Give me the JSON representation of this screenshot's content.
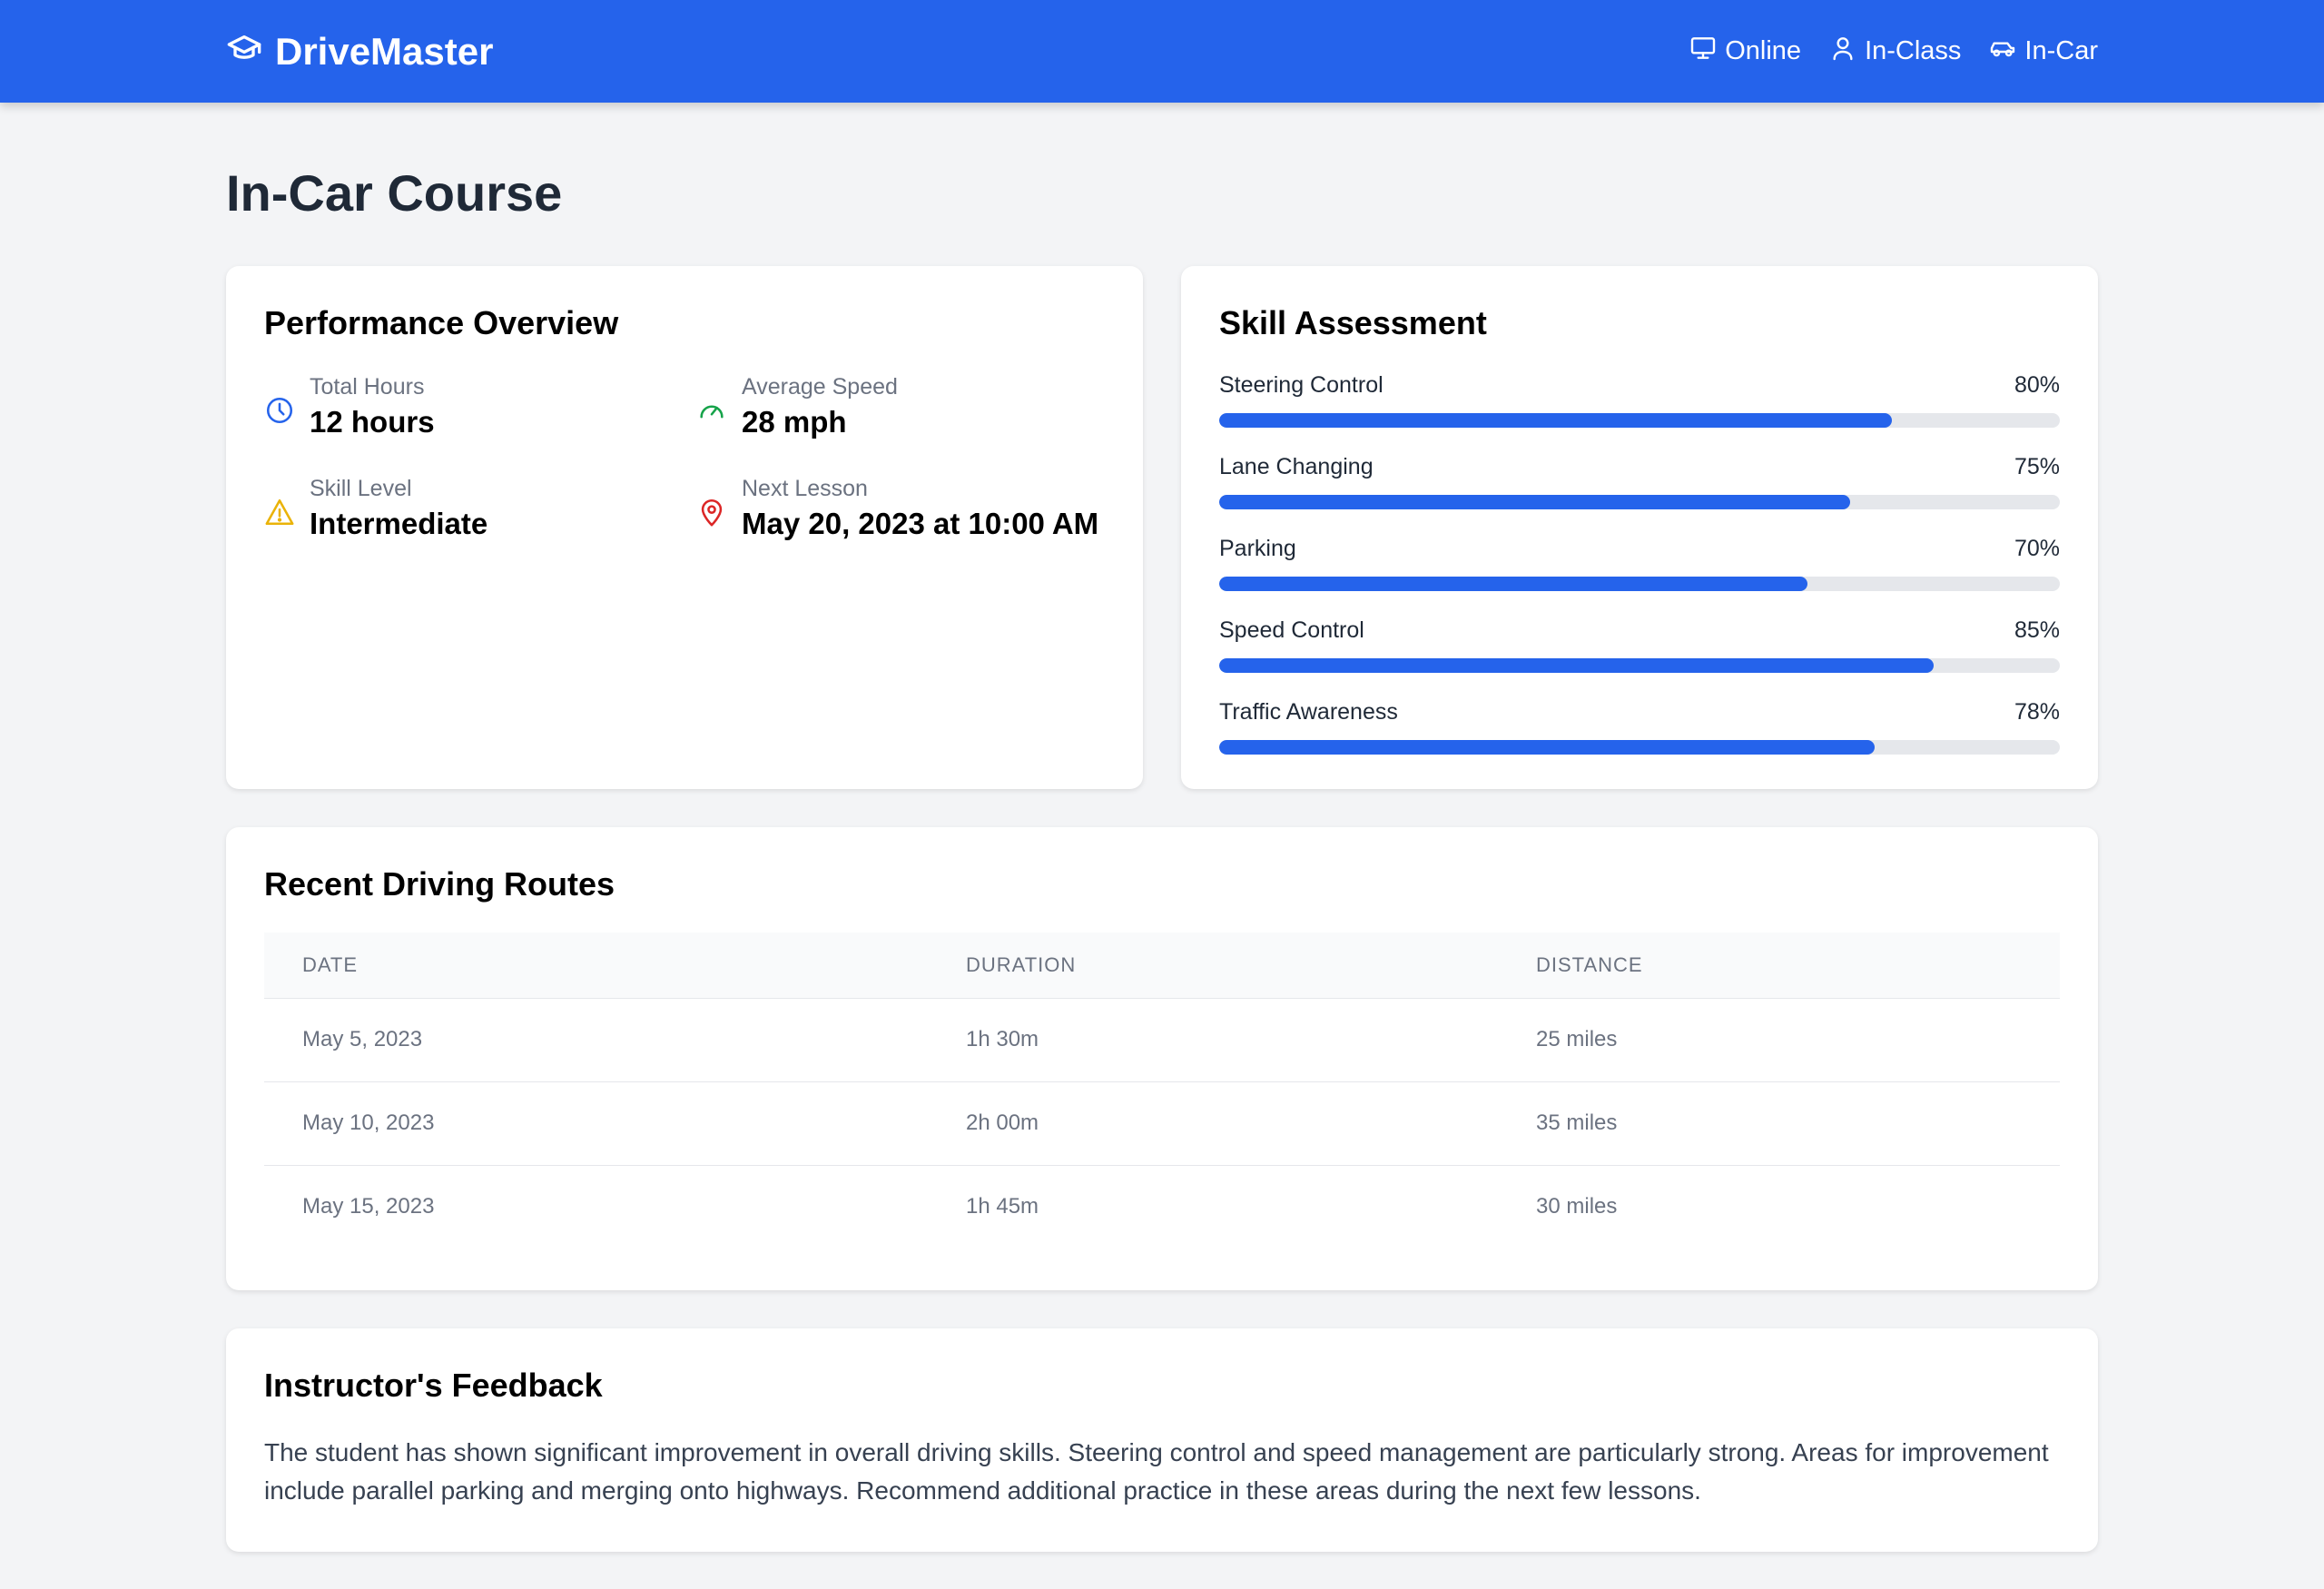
{
  "app": {
    "name": "DriveMaster",
    "logo_icon": "graduation-cap-icon"
  },
  "nav": [
    {
      "label": "Online",
      "icon": "monitor-icon"
    },
    {
      "label": "In-Class",
      "icon": "user-icon"
    },
    {
      "label": "In-Car",
      "icon": "car-icon"
    }
  ],
  "page": {
    "title": "In-Car Course"
  },
  "performance": {
    "title": "Performance Overview",
    "stats": [
      {
        "label": "Total Hours",
        "value": "12 hours",
        "icon": "clock-icon",
        "color": "#2563eb"
      },
      {
        "label": "Average Speed",
        "value": "28 mph",
        "icon": "speedometer-icon",
        "color": "#16a34a"
      },
      {
        "label": "Skill Level",
        "value": "Intermediate",
        "icon": "warning-icon",
        "color": "#eab308"
      },
      {
        "label": "Next Lesson",
        "value": "May 20, 2023 at 10:00 AM",
        "icon": "map-pin-icon",
        "color": "#dc2626"
      }
    ]
  },
  "skills": {
    "title": "Skill Assessment",
    "items": [
      {
        "name": "Steering Control",
        "percent_label": "80%",
        "percent": 80
      },
      {
        "name": "Lane Changing",
        "percent_label": "75%",
        "percent": 75
      },
      {
        "name": "Parking",
        "percent_label": "70%",
        "percent": 70
      },
      {
        "name": "Speed Control",
        "percent_label": "85%",
        "percent": 85
      },
      {
        "name": "Traffic Awareness",
        "percent_label": "78%",
        "percent": 78
      }
    ]
  },
  "routes": {
    "title": "Recent Driving Routes",
    "columns": [
      "DATE",
      "DURATION",
      "DISTANCE"
    ],
    "rows": [
      [
        "May 5, 2023",
        "1h 30m",
        "25 miles"
      ],
      [
        "May 10, 2023",
        "2h 00m",
        "35 miles"
      ],
      [
        "May 15, 2023",
        "1h 45m",
        "30 miles"
      ]
    ]
  },
  "feedback": {
    "title": "Instructor's Feedback",
    "text": "The student has shown significant improvement in overall driving skills. Steering control and speed management are particularly strong. Areas for improvement include parallel parking and merging onto highways. Recommend additional practice in these areas during the next few lessons."
  },
  "colors": {
    "brand": "#2563eb",
    "background": "#f3f4f6",
    "bar_track": "#e5e7eb"
  }
}
